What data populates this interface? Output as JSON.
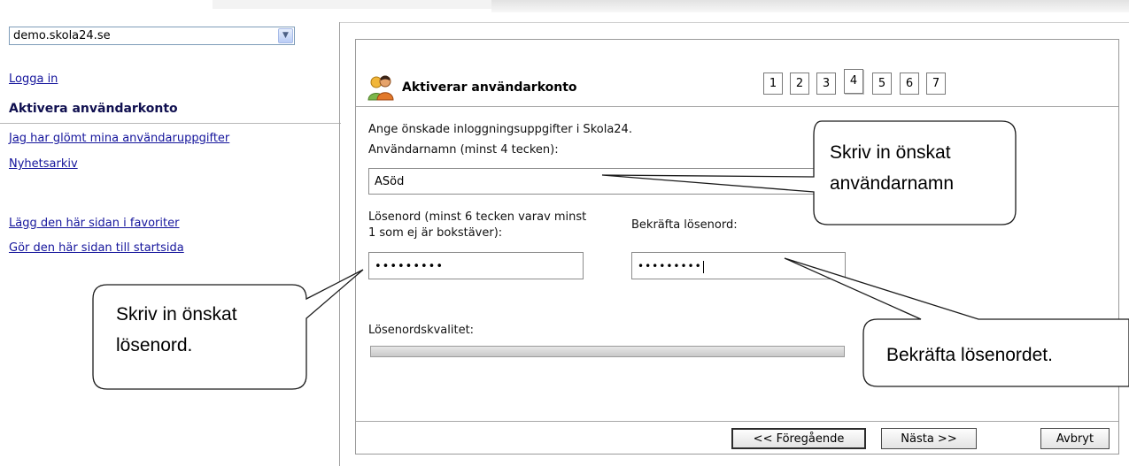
{
  "sidebar": {
    "site_select_value": "demo.skola24.se",
    "links": {
      "login": "Logga in",
      "active": "Aktivera användarkonto",
      "forgot": "Jag har glömt mina användaruppgifter",
      "news": "Nyhetsarkiv",
      "favorites": "Lägg den här sidan i favoriter",
      "startpage": "Gör den här sidan till startsida"
    }
  },
  "wizard": {
    "title": "Aktiverar användarkonto",
    "steps": [
      "1",
      "2",
      "3",
      "4",
      "5",
      "6",
      "7"
    ],
    "current_step": 4,
    "intro": "Ange önskade inloggningsuppgifter i Skola24.",
    "username_label": "Användarnamn (minst 4 tecken):",
    "username_value": "ASöd",
    "password_label_line1": "Lösenord (minst 6 tecken varav minst",
    "password_label_line2": "1 som ej är bokstäver):",
    "password_value": "•••••••••",
    "confirm_label": "Bekräfta lösenord:",
    "confirm_value": "•••••••••",
    "quality_label": "Lösenordskvalitet:",
    "buttons": {
      "previous": "<< Föregående",
      "next": "Nästa >>",
      "cancel": "Avbryt"
    }
  },
  "callouts": {
    "username_line1": "Skriv in önskat",
    "username_line2": "användarnamn",
    "password_line1": "Skriv in önskat",
    "password_line2": "lösenord.",
    "confirm": "Bekräfta lösenordet."
  },
  "icons": [
    "dropdown-arrow-icon",
    "users-icon"
  ]
}
